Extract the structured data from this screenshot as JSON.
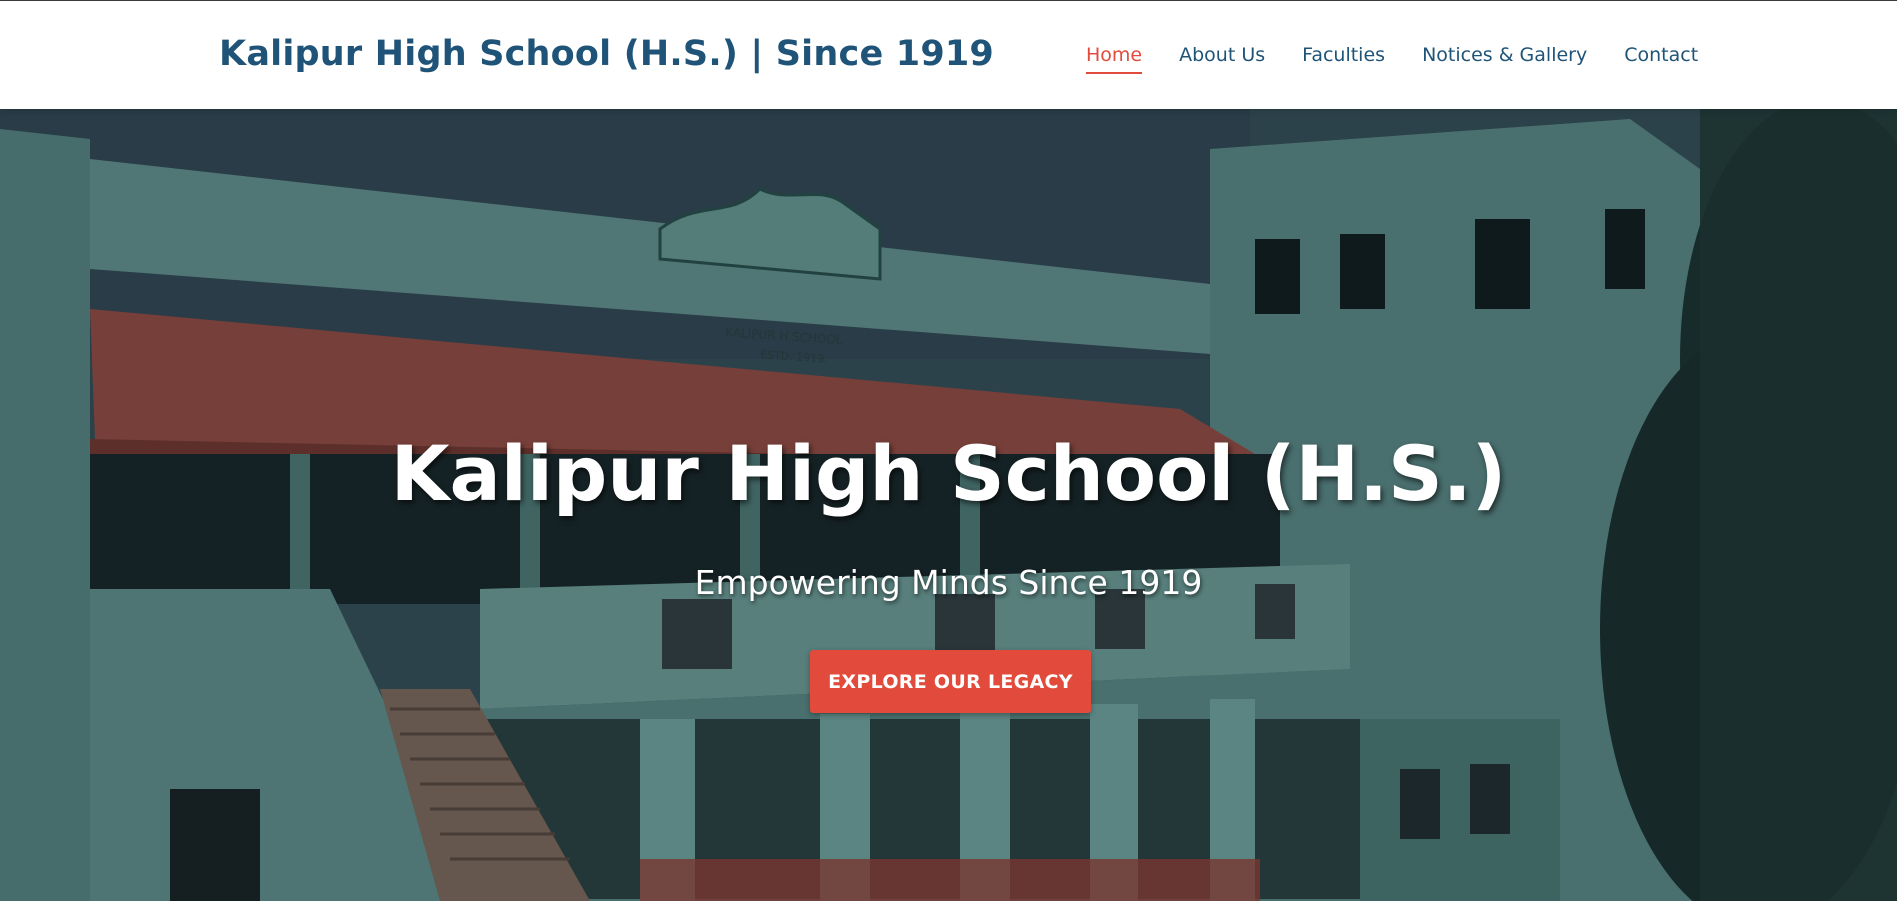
{
  "header": {
    "brand": "Kalipur High School (H.S.) | Since 1919",
    "nav": [
      {
        "label": "Home",
        "active": true
      },
      {
        "label": "About Us",
        "active": false
      },
      {
        "label": "Faculties",
        "active": false
      },
      {
        "label": "Notices & Gallery",
        "active": false
      },
      {
        "label": "Contact",
        "active": false
      }
    ]
  },
  "hero": {
    "title": "Kalipur High School (H.S.)",
    "subtitle": "Empowering Minds Since 1919",
    "cta_label": "EXPLORE OUR LEGACY",
    "building_sign_line1": "KALIPUR H.SCHOOL",
    "building_sign_line2": "ESTD. 1919."
  },
  "colors": {
    "brand": "#1f5478",
    "accent": "#e24b3c",
    "header_bg": "#ffffff"
  }
}
